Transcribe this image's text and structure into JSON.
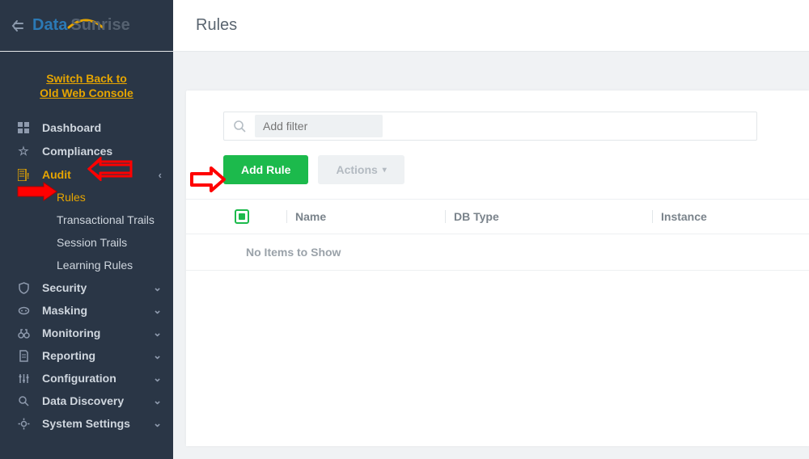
{
  "logo": {
    "part1": "Data",
    "part2": "Sunrise"
  },
  "page_title": "Rules",
  "switch_link_line1": "Switch Back to",
  "switch_link_line2": "Old Web Console",
  "sidebar": {
    "items": [
      {
        "label": "Dashboard",
        "chev": ""
      },
      {
        "label": "Compliances",
        "chev": ""
      },
      {
        "label": "Audit",
        "chev": "‹"
      },
      {
        "label": "Rules",
        "chev": ""
      },
      {
        "label": "Transactional Trails",
        "chev": ""
      },
      {
        "label": "Session Trails",
        "chev": ""
      },
      {
        "label": "Learning Rules",
        "chev": ""
      },
      {
        "label": "Security",
        "chev": "⌄"
      },
      {
        "label": "Masking",
        "chev": "⌄"
      },
      {
        "label": "Monitoring",
        "chev": "⌄"
      },
      {
        "label": "Reporting",
        "chev": "⌄"
      },
      {
        "label": "Configuration",
        "chev": "⌄"
      },
      {
        "label": "Data Discovery",
        "chev": "⌄"
      },
      {
        "label": "System Settings",
        "chev": "⌄"
      }
    ]
  },
  "filter": {
    "placeholder": "Add filter"
  },
  "buttons": {
    "add_rule": "Add Rule",
    "actions": "Actions"
  },
  "table": {
    "columns": {
      "name": "Name",
      "db_type": "DB Type",
      "instance": "Instance"
    },
    "empty": "No Items to Show"
  }
}
